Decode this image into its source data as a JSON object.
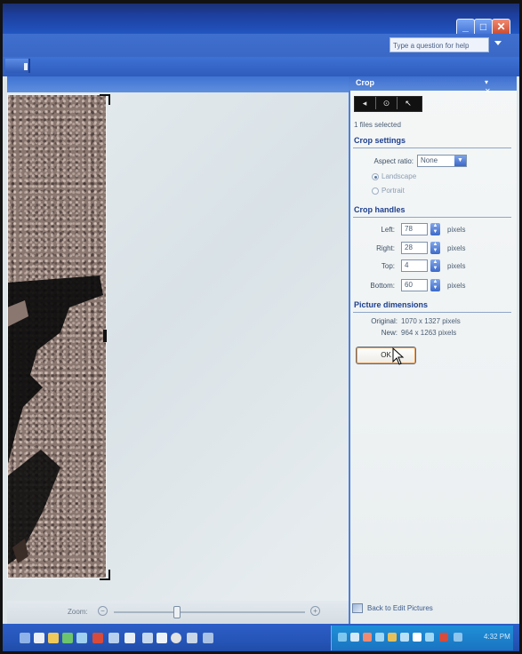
{
  "window": {
    "help_placeholder": "Type a question for help"
  },
  "window_buttons": {
    "minimize": "_",
    "maximize": "□",
    "close": "✕"
  },
  "zoom": {
    "label": "Zoom:",
    "out_icon": "magnifier-minus-icon",
    "in_icon": "magnifier-plus-icon",
    "level": 0.33
  },
  "task_pane": {
    "title": "Crop",
    "tabs": [
      "◂",
      "⊙",
      "↖"
    ],
    "files_selected": "1 files selected",
    "crop_settings": {
      "heading": "Crop settings",
      "aspect_ratio_label": "Aspect ratio:",
      "aspect_ratio_value": "None",
      "orientation": [
        {
          "label": "Landscape",
          "checked": true
        },
        {
          "label": "Portrait",
          "checked": false
        }
      ]
    },
    "crop_handles": {
      "heading": "Crop handles",
      "left": {
        "label": "Left:",
        "value": "78",
        "unit": "pixels"
      },
      "right": {
        "label": "Right:",
        "value": "28",
        "unit": "pixels"
      },
      "top": {
        "label": "Top:",
        "value": "4",
        "unit": "pixels"
      },
      "bottom": {
        "label": "Bottom:",
        "value": "60",
        "unit": "pixels"
      }
    },
    "picture_dimensions": {
      "heading": "Picture dimensions",
      "original_label": "Original:",
      "original_value": "1070 x 1327 pixels",
      "new_label": "New:",
      "new_value": "964 x 1263 pixels"
    },
    "ok_button": "OK",
    "back_link": "Back to Edit Pictures"
  },
  "taskbar": {
    "clock": "4:32 PM"
  },
  "colors": {
    "accent": "#2153bd",
    "taskbar": "#2554b6",
    "tray": "#1a74c0",
    "section_heading": "#1d3f8e"
  }
}
